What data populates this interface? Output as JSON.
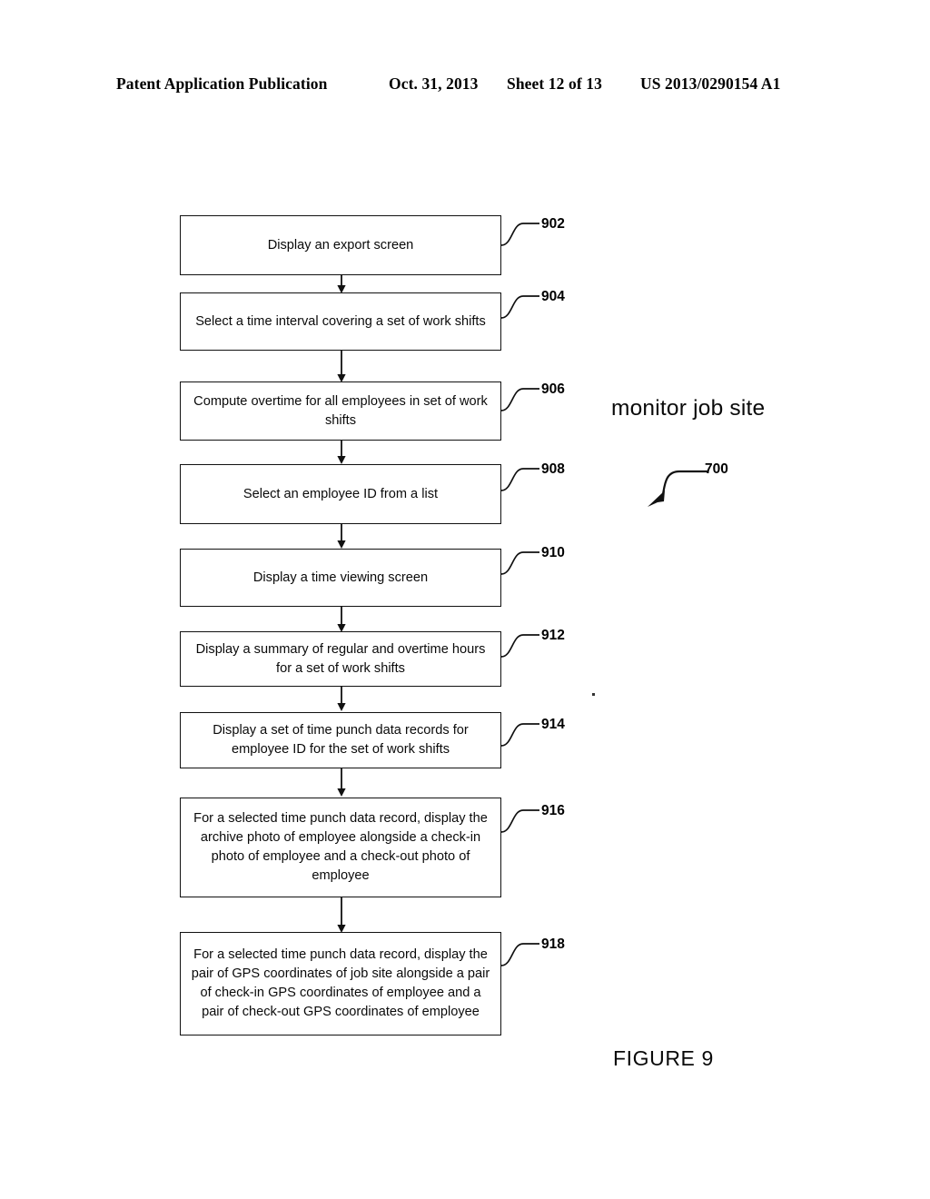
{
  "header": {
    "publication": "Patent Application Publication",
    "date": "Oct. 31, 2013",
    "sheet": "Sheet 12 of 13",
    "patent_number": "US 2013/0290154 A1"
  },
  "figure": {
    "caption": "FIGURE 9",
    "system_label": "monitor job site",
    "system_ref": "700"
  },
  "flowchart": {
    "steps": [
      {
        "ref": "902",
        "text": "Display an export screen"
      },
      {
        "ref": "904",
        "text": "Select a time interval covering a set of work shifts"
      },
      {
        "ref": "906",
        "text": "Compute overtime for all employees in set of work shifts"
      },
      {
        "ref": "908",
        "text": "Select an employee ID from a list"
      },
      {
        "ref": "910",
        "text": "Display a time viewing screen"
      },
      {
        "ref": "912",
        "text": "Display a summary of regular and overtime hours for a set of work shifts"
      },
      {
        "ref": "914",
        "text": "Display a set of time punch data records for employee ID for the set of work shifts"
      },
      {
        "ref": "916",
        "text": "For a selected time punch data record, display the archive photo of employee alongside a check-in photo of employee and a check-out photo of employee"
      },
      {
        "ref": "918",
        "text": "For a selected time punch data record, display the pair of GPS coordinates of job site alongside a pair of check-in GPS coordinates of employee and a pair of check-out GPS coordinates of employee"
      }
    ]
  }
}
